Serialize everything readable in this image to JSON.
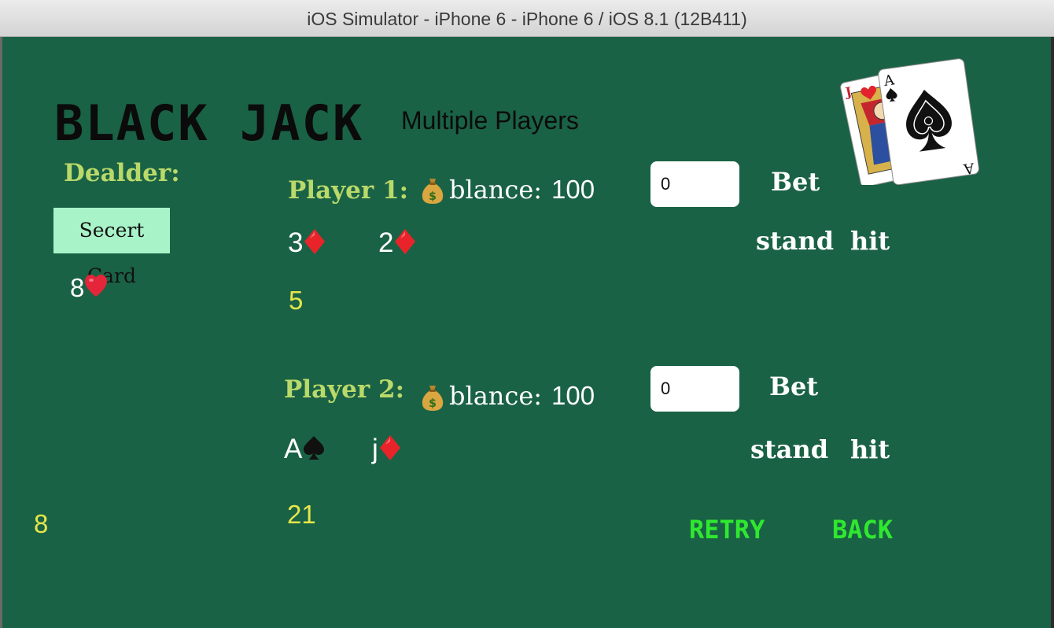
{
  "window": {
    "title": "iOS Simulator - iPhone 6 - iPhone 6 / iOS 8.1 (12B411)"
  },
  "game": {
    "title": "BLACK JACK",
    "mode": "Multiple Players"
  },
  "dealer": {
    "label": "Dealder:",
    "secret_card_label": "Secert Card",
    "card": {
      "rank": "8",
      "suit": "heart-icon"
    },
    "total": "8"
  },
  "players": [
    {
      "label": "Player 1:",
      "balance_label": "blance:",
      "balance": "100",
      "bet_value": "0",
      "bet_label": "Bet",
      "stand_label": "stand",
      "hit_label": "hit",
      "cards": [
        {
          "rank": "3",
          "suit": "diamond-icon"
        },
        {
          "rank": "2",
          "suit": "diamond-icon"
        }
      ],
      "total": "5"
    },
    {
      "label": "Player 2:",
      "balance_label": "blance:",
      "balance": "100",
      "bet_value": "0",
      "bet_label": "Bet",
      "stand_label": "stand",
      "hit_label": "hit",
      "cards": [
        {
          "rank": "A",
          "suit": "spade-icon"
        },
        {
          "rank": "j",
          "suit": "diamond-icon"
        }
      ],
      "total": "21"
    }
  ],
  "actions": {
    "retry_label": "RETRY",
    "back_label": "BACK"
  },
  "colors": {
    "table_green": "#1a6245",
    "label_yellow_green": "#b9d96a",
    "total_yellow": "#e6e64a",
    "action_green": "#2fe82f",
    "secret_card_bg": "#a9f3c8"
  },
  "icons": [
    "money-bag-icon",
    "playing-cards-icon",
    "diamond-icon",
    "heart-icon",
    "spade-icon"
  ]
}
